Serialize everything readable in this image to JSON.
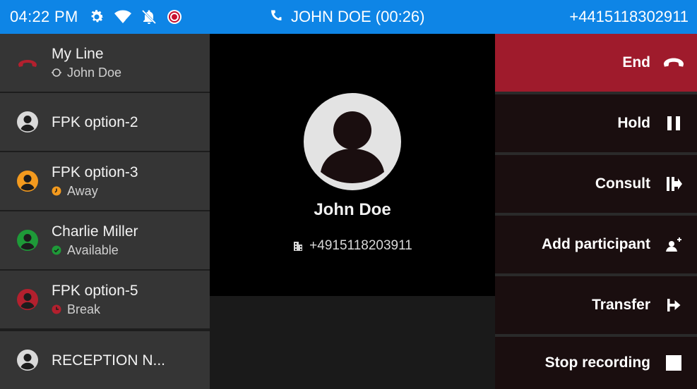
{
  "status_bar": {
    "time": "04:22 PM",
    "call_title": "JOHN DOE (00:26)",
    "own_number": "+4415118302911",
    "icons": [
      "gear-icon",
      "wifi-icon",
      "bell-off-icon",
      "record-icon",
      "phone-icon"
    ]
  },
  "line_keys": [
    {
      "name": "My Line",
      "sub": "John Doe",
      "icon": "phone-hangup-icon",
      "color": "#b3202e"
    },
    {
      "name": "FPK option-2",
      "sub": "",
      "icon": "avatar-icon",
      "color": "#d9d9d9"
    },
    {
      "name": "FPK option-3",
      "sub": "Away",
      "icon": "avatar-icon",
      "color": "#f39a1e"
    },
    {
      "name": "Charlie Miller",
      "sub": "Available",
      "icon": "avatar-icon",
      "color": "#1e9a38"
    },
    {
      "name": "FPK option-5",
      "sub": "Break",
      "icon": "avatar-icon",
      "color": "#b3202e"
    },
    {
      "name": "RECEPTION N...",
      "sub": "",
      "icon": "avatar-icon",
      "color": "#d9d9d9"
    }
  ],
  "contact": {
    "name": "John Doe",
    "number": "+4915118203911",
    "number_icon": "building-icon"
  },
  "actions": [
    {
      "label": "End",
      "icon": "phone-hangup-icon"
    },
    {
      "label": "Hold",
      "icon": "pause-icon"
    },
    {
      "label": "Consult",
      "icon": "consult-icon"
    },
    {
      "label": "Add participant",
      "icon": "add-participant-icon"
    },
    {
      "label": "Transfer",
      "icon": "transfer-icon"
    },
    {
      "label": "Stop recording",
      "icon": "stop-icon"
    }
  ],
  "colors": {
    "status_bar": "#0e85e6",
    "end_button": "#9f1b2c",
    "action_bg": "#1a0e0f",
    "line_key_bg": "#353535",
    "away": "#f39a1e",
    "available": "#1e9a38",
    "break": "#b3202e"
  }
}
